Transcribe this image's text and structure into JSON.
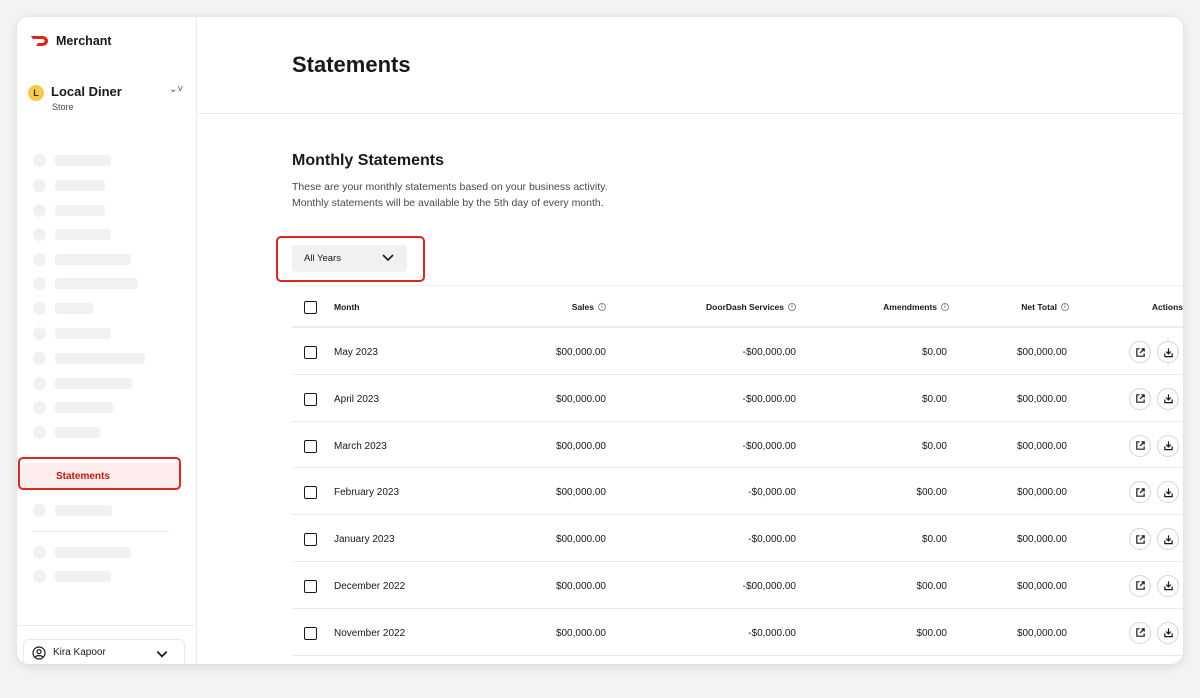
{
  "app": {
    "brand": "Merchant"
  },
  "store": {
    "avatar": "L",
    "name": "Local Diner",
    "type": "Store"
  },
  "nav": {
    "active_label": "Statements"
  },
  "user": {
    "name": "Kira Kapoor"
  },
  "page": {
    "title": "Statements"
  },
  "section": {
    "title": "Monthly Statements",
    "desc_line1": "These are your monthly statements based on your business activity.",
    "desc_line2": "Monthly statements will be available by the 5th day of every month."
  },
  "filter": {
    "year_value": "All Years"
  },
  "table": {
    "headers": {
      "month": "Month",
      "sales": "Sales",
      "doordash": "DoorDash Services",
      "amendments": "Amendments",
      "net": "Net Total",
      "actions": "Actions"
    },
    "rows": [
      {
        "month": "May 2023",
        "sales": "$00,000.00",
        "doordash": "-$00,000.00",
        "amendments": "$0.00",
        "net": "$00,000.00"
      },
      {
        "month": "April 2023",
        "sales": "$00,000.00",
        "doordash": "-$00,000.00",
        "amendments": "$0.00",
        "net": "$00,000.00"
      },
      {
        "month": "March 2023",
        "sales": "$00,000.00",
        "doordash": "-$00,000.00",
        "amendments": "$0.00",
        "net": "$00,000.00"
      },
      {
        "month": "February 2023",
        "sales": "$00,000.00",
        "doordash": "-$0,000.00",
        "amendments": "$00.00",
        "net": "$00,000.00"
      },
      {
        "month": "January 2023",
        "sales": "$00,000.00",
        "doordash": "-$0,000.00",
        "amendments": "$0.00",
        "net": "$00,000.00"
      },
      {
        "month": "December 2022",
        "sales": "$00,000.00",
        "doordash": "-$00,000.00",
        "amendments": "$00.00",
        "net": "$00,000.00"
      },
      {
        "month": "November 2022",
        "sales": "$00,000.00",
        "doordash": "-$0,000.00",
        "amendments": "$00.00",
        "net": "$00,000.00"
      }
    ]
  },
  "colors": {
    "accent": "#e1251b",
    "active_bg": "#fdeeed",
    "skeleton": "#f1f1f1"
  },
  "icons": {
    "brand": "doordash-logo-icon",
    "open": "open-external-icon",
    "download": "download-icon",
    "info": "info-icon",
    "user": "user-circle-icon",
    "chevron": "chevron-down-icon"
  }
}
